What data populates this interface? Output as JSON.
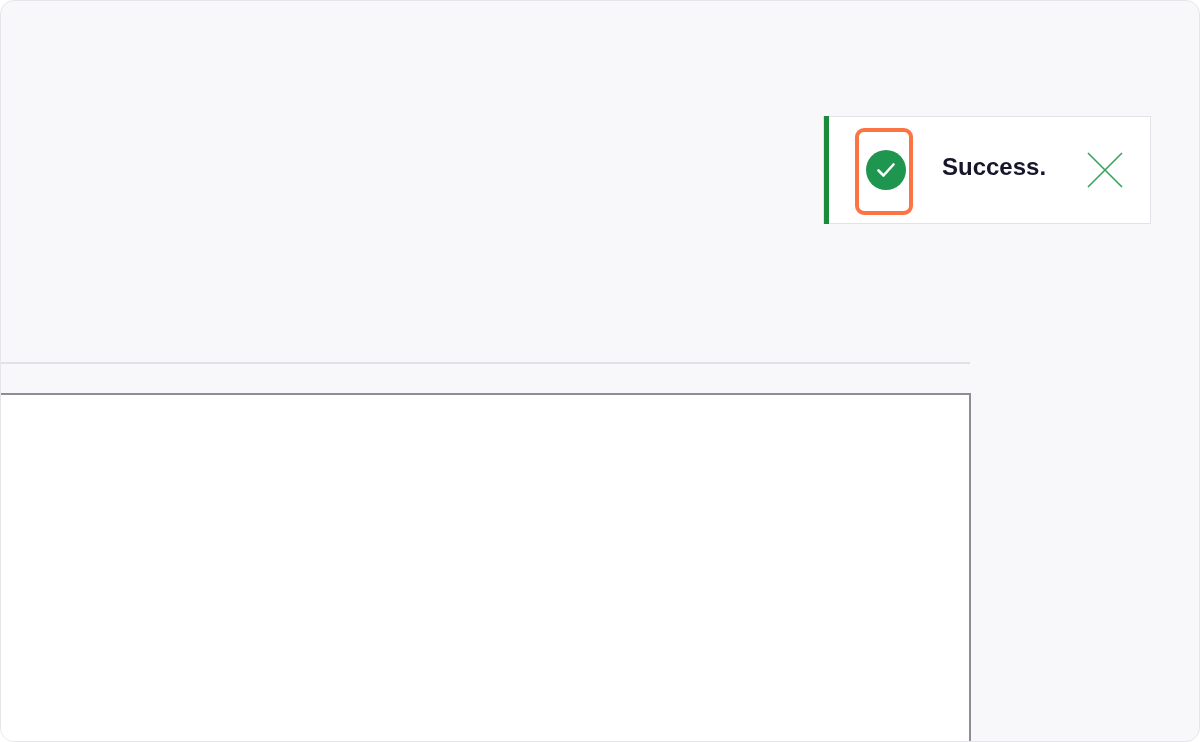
{
  "toast": {
    "kind": "success",
    "message": "Success.",
    "icon_highlighted": true
  }
}
